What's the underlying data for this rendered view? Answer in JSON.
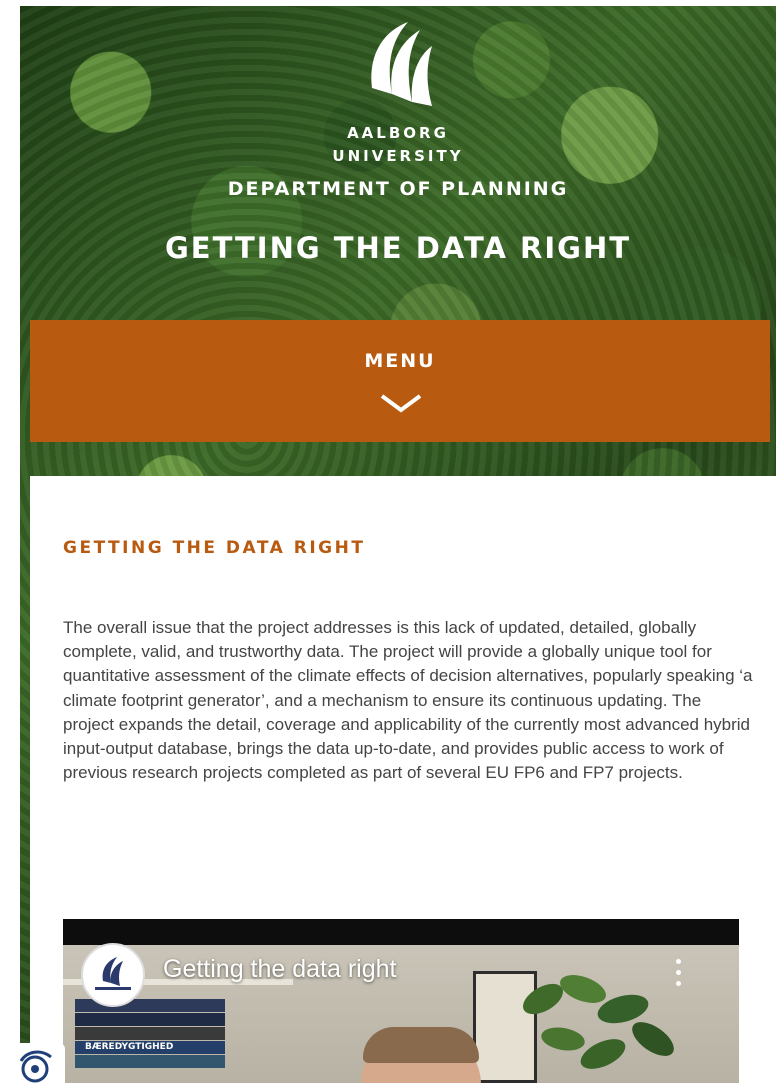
{
  "header": {
    "university_line1": "AALBORG",
    "university_line2": "UNIVERSITY",
    "department": "DEPARTMENT OF PLANNING",
    "title": "GETTING THE DATA RIGHT"
  },
  "menu": {
    "label": "MENU",
    "icon": "chevron-down-icon"
  },
  "article": {
    "heading": "GETTING THE DATA RIGHT",
    "body": "The overall issue that the project addresses is this lack of updated, detailed, globally complete, valid, and trustworthy data. The project will provide a globally unique tool for quantitative assessment of the climate effects of decision alternatives, popularly speaking ‘a climate footprint generator’, and a mechanism to ensure its continuous updating. The project expands the detail, coverage and applicability of the currently most advanced hybrid input-output database, brings the data up-to-date, and provides public access to work of previous research projects completed as part of several EU FP6 and FP7 projects."
  },
  "video": {
    "title": "Getting the data right",
    "book_spine_text": "BÆREDYGTIGHED"
  },
  "colors": {
    "accent": "#b85b10",
    "body_text": "#444444"
  },
  "icons": [
    "university-logo-icon",
    "chevron-down-icon",
    "kebab-menu-icon",
    "accessibility-icon"
  ]
}
